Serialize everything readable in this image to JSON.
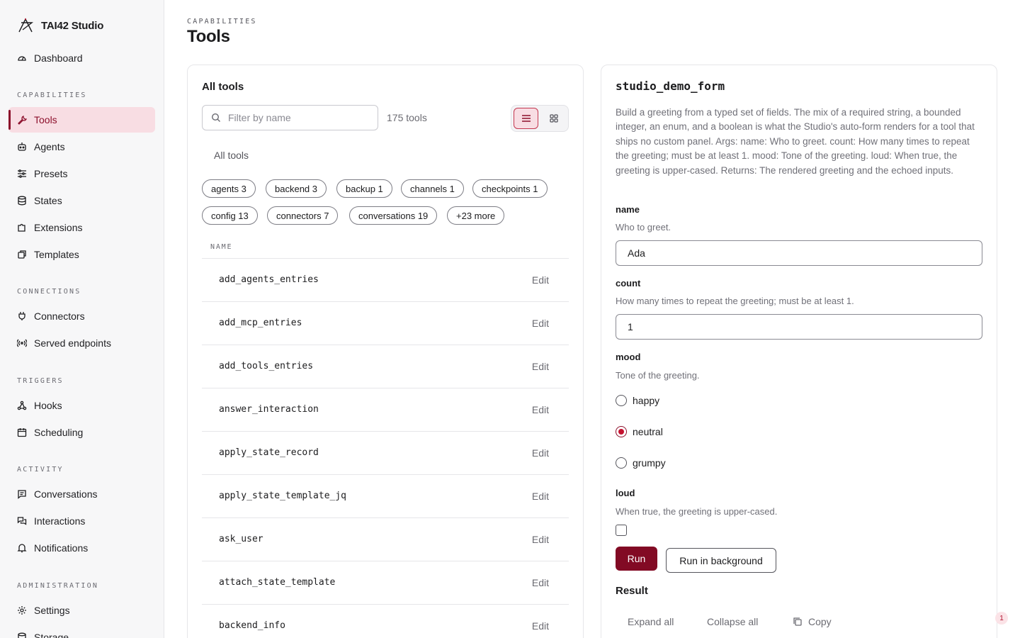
{
  "app": {
    "name": "TAI42 Studio"
  },
  "sidebar": {
    "dashboard": "Dashboard",
    "sections": {
      "capabilities": "CAPABILITIES",
      "connections": "CONNECTIONS",
      "triggers": "TRIGGERS",
      "activity": "ACTIVITY",
      "administration": "ADMINISTRATION"
    },
    "items": {
      "tools": "Tools",
      "agents": "Agents",
      "presets": "Presets",
      "states": "States",
      "extensions": "Extensions",
      "templates": "Templates",
      "connectors": "Connectors",
      "served_endpoints": "Served endpoints",
      "hooks": "Hooks",
      "scheduling": "Scheduling",
      "conversations": "Conversations",
      "interactions": "Interactions",
      "notifications": "Notifications",
      "settings": "Settings",
      "storage": "Storage"
    }
  },
  "header": {
    "eyebrow": "CAPABILITIES",
    "title": "Tools"
  },
  "tools_list": {
    "title": "All tools",
    "filter_placeholder": "Filter by name",
    "count": "175 tools",
    "tab": "All tools",
    "chips": [
      "agents 3",
      "backend 3",
      "backup 1",
      "channels 1",
      "checkpoints 1",
      "config 13",
      "connectors 7",
      "conversations 19",
      "+23 more"
    ],
    "column_header": "NAME",
    "edit_label": "Edit",
    "rows": [
      "add_agents_entries",
      "add_mcp_entries",
      "add_tools_entries",
      "answer_interaction",
      "apply_state_record",
      "apply_state_template_jq",
      "ask_user",
      "attach_state_template",
      "backend_info"
    ]
  },
  "tool_detail": {
    "name": "studio_demo_form",
    "description": "Build a greeting from a typed set of fields. The mix of a required string, a bounded integer, an enum, and a boolean is what the Studio's auto-form renders for a tool that ships no custom panel. Args: name: Who to greet. count: How many times to repeat the greeting; must be at least 1. mood: Tone of the greeting. loud: When true, the greeting is upper-cased. Returns: The rendered greeting and the echoed inputs.",
    "fields": {
      "name": {
        "label": "name",
        "help": "Who to greet.",
        "value": "Ada"
      },
      "count": {
        "label": "count",
        "help": "How many times to repeat the greeting; must be at least 1.",
        "value": "1"
      },
      "mood": {
        "label": "mood",
        "help": "Tone of the greeting.",
        "options": [
          "happy",
          "neutral",
          "grumpy"
        ],
        "selected": "neutral"
      },
      "loud": {
        "label": "loud",
        "help": "When true, the greeting is upper-cased.",
        "checked": false
      }
    },
    "run_label": "Run",
    "run_background_label": "Run in background",
    "result_label": "Result",
    "expand_all": "Expand all",
    "collapse_all": "Collapse all",
    "copy": "Copy"
  },
  "notification_badge": "1",
  "colors": {
    "accent": "#820a24",
    "accent_soft": "#f8dde3"
  }
}
